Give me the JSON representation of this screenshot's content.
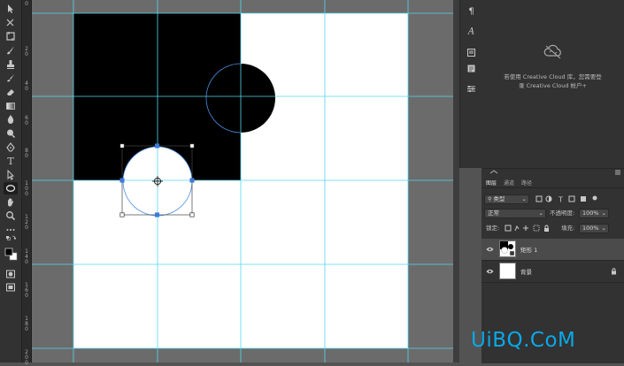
{
  "toolbar": {
    "tools": [
      {
        "name": "move-tool",
        "icon": "move-icon"
      },
      {
        "name": "marquee-tool",
        "icon": "marquee-icon"
      },
      {
        "name": "lasso-tool",
        "icon": "lasso-icon"
      },
      {
        "name": "magic-wand-tool",
        "icon": "wand-icon"
      },
      {
        "name": "crop-tool",
        "icon": "crop-icon"
      },
      {
        "name": "eyedropper-tool",
        "icon": "eyedropper-icon"
      },
      {
        "name": "brush-tool",
        "icon": "brush-icon"
      },
      {
        "name": "stamp-tool",
        "icon": "stamp-icon"
      },
      {
        "name": "history-brush-tool",
        "icon": "history-brush-icon"
      },
      {
        "name": "eraser-tool",
        "icon": "eraser-icon"
      },
      {
        "name": "gradient-tool",
        "icon": "gradient-icon"
      },
      {
        "name": "blur-tool",
        "icon": "blur-icon"
      },
      {
        "name": "dodge-tool",
        "icon": "dodge-icon"
      },
      {
        "name": "pen-tool",
        "icon": "pen-icon"
      },
      {
        "name": "type-tool",
        "icon": "type-icon"
      },
      {
        "name": "path-selection-tool",
        "icon": "arrow-icon"
      },
      {
        "name": "ellipse-tool",
        "icon": "ellipse-icon"
      },
      {
        "name": "hand-tool",
        "icon": "hand-icon"
      },
      {
        "name": "zoom-tool",
        "icon": "zoom-icon"
      },
      {
        "name": "more-tools",
        "icon": "ellipsis-icon"
      },
      {
        "name": "swap-colors",
        "icon": "swap-icon"
      },
      {
        "name": "color-swatches",
        "icon": "swatches-icon"
      },
      {
        "name": "quick-mask",
        "icon": "quick-mask-icon"
      },
      {
        "name": "screen-mode",
        "icon": "screen-mode-icon"
      }
    ],
    "type_glyph": "T",
    "foreground_color": "#000000",
    "background_color": "#ffffff",
    "active_tool": "ellipse-tool"
  },
  "ruler": {
    "labels": [
      "0",
      "2\n0",
      "4\n0",
      "6\n0",
      "8\n0",
      "1\n0\n0",
      "1\n2\n0",
      "1\n4\n0",
      "1\n6\n0",
      "1\n8\n0",
      "2\n0\n0"
    ]
  },
  "canvas": {
    "document_color": "#ffffff",
    "pasteboard_color": "#6b6b6b",
    "guide_color": "#55d6f0",
    "shape_color": "#000000",
    "path_color": "#4a90e2",
    "transform_handle_color": "#3d7bd9"
  },
  "right_panels": {
    "icons": [
      "paragraph-icon",
      "character-style-icon",
      "library-icon",
      "notes-icon",
      "adjustments-icon"
    ],
    "paragraph_glyph": "¶",
    "character_glyph": "A",
    "library_message": "若使用 Creative Cloud 库，您需要登\n录 Creative Cloud 帐户+",
    "library_icon": "creative-cloud-icon"
  },
  "layers_panel": {
    "tabs": [
      "图层",
      "通道",
      "路径"
    ],
    "active_tab": "图层",
    "filter_kind": "类型",
    "blend_mode": "正常",
    "opacity_label": "不透明度:",
    "opacity_value": "100%",
    "lock_label": "锁定:",
    "fill_label": "填充:",
    "fill_value": "100%",
    "layers": [
      {
        "name": "矩形 1",
        "visible": true,
        "selected": true,
        "type": "shape"
      },
      {
        "name": "背景",
        "visible": true,
        "selected": false,
        "type": "background",
        "locked": true
      }
    ]
  },
  "watermark": {
    "text": "UiBQ.CoM"
  }
}
